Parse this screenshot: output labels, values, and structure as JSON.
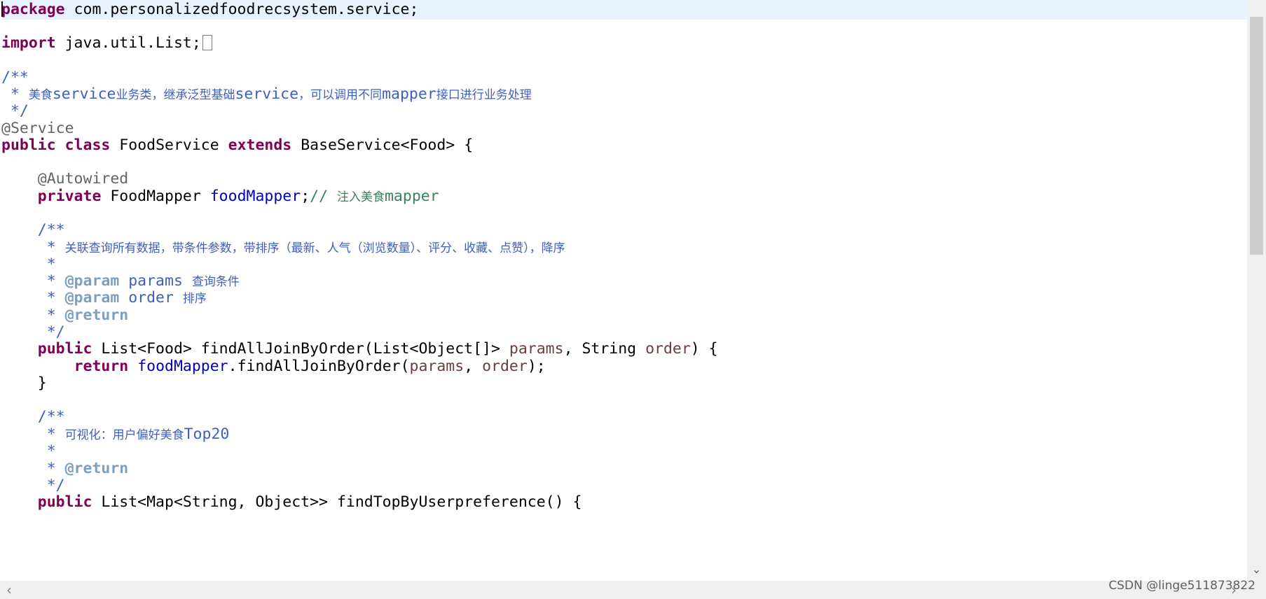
{
  "editor": {
    "package_kw": "package",
    "package_name": " com.personalizedfoodrecsystem.service;",
    "import_kw": "import",
    "import_name": " java.util.List;",
    "class_doc_open": "/**",
    "class_doc_star": " * ",
    "class_doc_t1": "美食",
    "class_doc_t2": "service",
    "class_doc_t3": "业务类，继承泛型基础",
    "class_doc_t4": "service",
    "class_doc_t5": "，可以调用不同",
    "class_doc_t6": "mapper",
    "class_doc_t7": "接口进行业务处理",
    "class_doc_close": " */",
    "service_annotation": "@Service",
    "kw_public": "public",
    "kw_class": "class",
    "class_name": " FoodService ",
    "kw_extends": "extends",
    "base_class": " BaseService<Food> {",
    "autowired_annotation": "    @Autowired",
    "indent4": "    ",
    "kw_private": "private",
    "field_type": " FoodMapper ",
    "field_name": "foodMapper",
    "semicolon": ";",
    "comment_slashes": "// ",
    "comment_t1": "注入美食",
    "comment_t2": "mapper",
    "doc_open": "    /**",
    "doc_star": "     * ",
    "doc_star_only": "     *",
    "doc_close": "     */",
    "m1_desc": "关联查询所有数据，带条件参数，带排序（最新、人气（浏览数量）、评分、收藏、点赞），降序",
    "tag_param": "@param",
    "tag_return": "@return",
    "param_params": " params ",
    "param_params_desc": "查询条件",
    "param_order": " order ",
    "param_order_desc": "排序",
    "m1_ret_type": " List<Food> findAllJoinByOrder(List<Object[]> ",
    "m1_p1": "params",
    "m1_mid": ", String ",
    "m1_p2": "order",
    "m1_end": ") {",
    "indent8": "        ",
    "kw_return": "return",
    "call_field": "foodMapper",
    "call_method": ".findAllJoinByOrder(",
    "call_p1": "params",
    "call_mid": ", ",
    "call_p2": "order",
    "call_end": ");",
    "close_brace": "    }",
    "m2_desc1": "可视化：用户偏好美食",
    "m2_desc2": "Top20",
    "m2_sig": " List<Map<String, Object>> findTopByUserpreference() {"
  },
  "scrollbar": {
    "down_arrow": "⌄",
    "left_arrow": "‹",
    "right_arrow": "›"
  },
  "watermark": "CSDN @linge511873822",
  "colors": {
    "keyword": "#7f0055",
    "annotation": "#646464",
    "javadoc": "#3f5fbf",
    "javadoc_tag": "#7f9fbf",
    "field": "#0000c0",
    "comment": "#3f7f5f",
    "parameter": "#6a3e3e",
    "current_line": "#e8f2fe"
  }
}
